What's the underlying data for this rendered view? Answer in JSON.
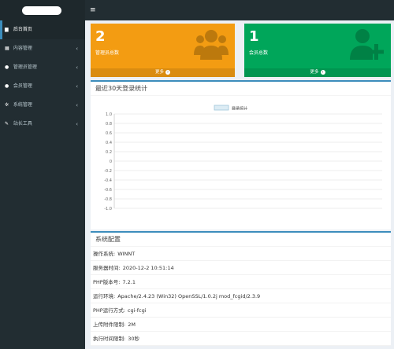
{
  "topbar": {
    "menu_icon": "hamburger-icon"
  },
  "sidebar": {
    "items": [
      {
        "label": "后台首页",
        "icon": "dashboard-icon",
        "glyph": "▆",
        "active": true,
        "has_chevron": false
      },
      {
        "label": "内容管理",
        "icon": "grid-icon",
        "glyph": "▦",
        "active": false,
        "has_chevron": true
      },
      {
        "label": "管理员管理",
        "icon": "users-icon",
        "glyph": "●",
        "active": false,
        "has_chevron": true
      },
      {
        "label": "会员管理",
        "icon": "user-group-icon",
        "glyph": "●",
        "active": false,
        "has_chevron": true
      },
      {
        "label": "系统管理",
        "icon": "gear-icon",
        "glyph": "✲",
        "active": false,
        "has_chevron": true
      },
      {
        "label": "站长工具",
        "icon": "wrench-icon",
        "glyph": "✎",
        "active": false,
        "has_chevron": true
      }
    ],
    "chevron": "‹"
  },
  "stats": {
    "admins": {
      "value": "2",
      "label": "管理员总数",
      "more": "更多",
      "color": "#f39c12"
    },
    "members": {
      "value": "1",
      "label": "会员总数",
      "more": "更多",
      "color": "#00a65a"
    }
  },
  "chart_panel": {
    "title": "最近30天登录统计"
  },
  "chart_data": {
    "type": "line",
    "title": "",
    "series": [
      {
        "name": "登录统计",
        "values": []
      }
    ],
    "yticks": [
      "1.0",
      "0.8",
      "0.6",
      "0.4",
      "0.2",
      "0",
      "-0.2",
      "-0.4",
      "-0.6",
      "-0.8",
      "-1.0"
    ],
    "ylim": [
      -1.0,
      1.0
    ],
    "grid": true,
    "legend": "top-center"
  },
  "system_panel": {
    "title": "系统配置",
    "rows": [
      {
        "label": "操作系统:",
        "value": "WINNT"
      },
      {
        "label": "服务器时间:",
        "value": "2020-12-2 10:51:14"
      },
      {
        "label": "PHP版本号:",
        "value": "7.2.1"
      },
      {
        "label": "运行环境:",
        "value": "Apache/2.4.23 (Win32) OpenSSL/1.0.2j mod_fcgid/2.3.9"
      },
      {
        "label": "PHP运行方式:",
        "value": "cgi-fcgi"
      },
      {
        "label": "上传附件限制:",
        "value": "2M"
      },
      {
        "label": "执行时间限制:",
        "value": "30秒"
      }
    ]
  }
}
